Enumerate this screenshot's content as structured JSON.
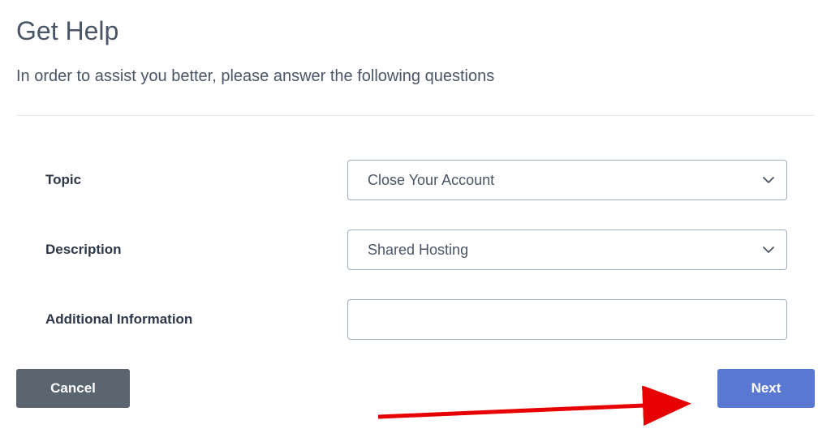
{
  "header": {
    "title": "Get Help",
    "subtitle": "In order to assist you better, please answer the following questions"
  },
  "form": {
    "topic": {
      "label": "Topic",
      "value": "Close Your Account"
    },
    "description": {
      "label": "Description",
      "value": "Shared Hosting"
    },
    "additional": {
      "label": "Additional Information",
      "value": ""
    }
  },
  "buttons": {
    "cancel": "Cancel",
    "next": "Next"
  },
  "annotation": {
    "arrow_color": "#e60000"
  }
}
